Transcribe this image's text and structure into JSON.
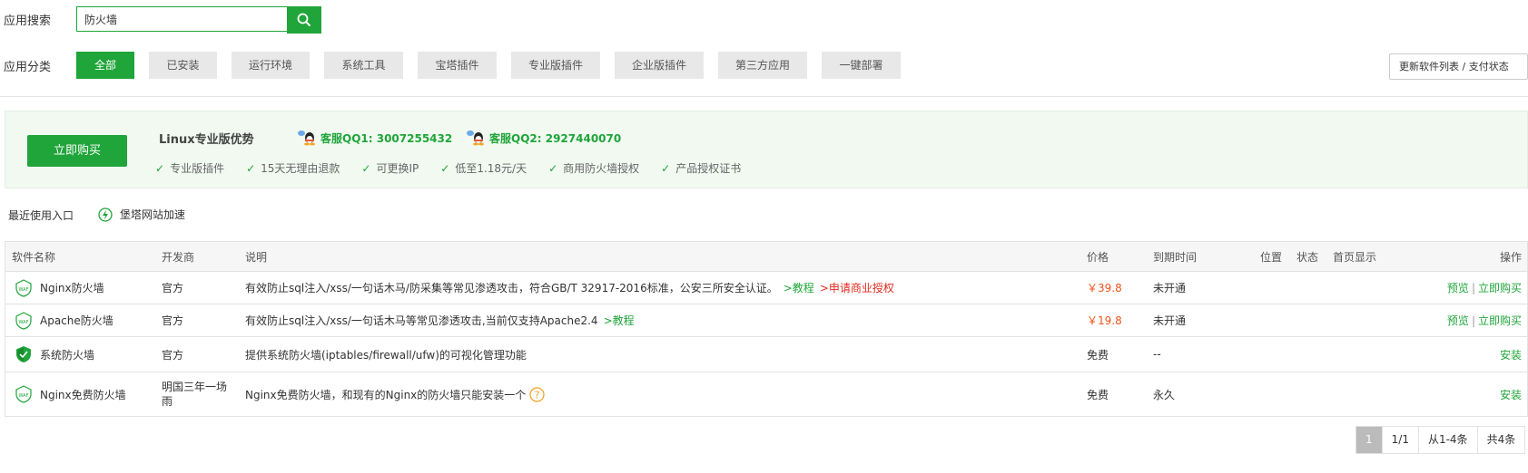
{
  "search": {
    "label": "应用搜索",
    "value": "防火墙"
  },
  "category": {
    "label": "应用分类",
    "tabs": [
      "全部",
      "已安装",
      "运行环境",
      "系统工具",
      "宝塔插件",
      "专业版插件",
      "企业版插件",
      "第三方应用",
      "一键部署"
    ],
    "active": "全部"
  },
  "update_button": "更新软件列表 / 支付状态",
  "promo": {
    "buy_button": "立即购买",
    "title": "Linux专业版优势",
    "qq1": "客服QQ1: 3007255432",
    "qq2": "客服QQ2: 2927440070",
    "benefits": [
      "专业版插件",
      "15天无理由退款",
      "可更换IP",
      "低至1.18元/天",
      "商用防火墙授权",
      "产品授权证书"
    ]
  },
  "recent": {
    "label": "最近使用入口",
    "item": "堡塔网站加速"
  },
  "table": {
    "headers": {
      "name": "软件名称",
      "dev": "开发商",
      "desc": "说明",
      "price": "价格",
      "expire": "到期时间",
      "loc": "位置",
      "status": "状态",
      "home": "首页显示",
      "op": "操作"
    },
    "rows": [
      {
        "name": "Nginx防火墙",
        "dev": "官方",
        "desc": "有效防止sql注入/xss/一句话木马/防采集等常见渗透攻击，符合GB/T 32917-2016标准，公安三所安全认证。",
        "link1": ">教程",
        "link2": ">申请商业授权",
        "price": "￥39.8",
        "expire": "未开通",
        "op1": "预览",
        "op2": "立即购买"
      },
      {
        "name": "Apache防火墙",
        "dev": "官方",
        "desc": "有效防止sql注入/xss/一句话木马等常见渗透攻击,当前仅支持Apache2.4",
        "link1": ">教程",
        "price": "￥19.8",
        "expire": "未开通",
        "op1": "预览",
        "op2": "立即购买"
      },
      {
        "name": "系统防火墙",
        "dev": "官方",
        "desc": "提供系统防火墙(iptables/firewall/ufw)的可视化管理功能",
        "price": "免费",
        "expire": "--",
        "op": "安装"
      },
      {
        "name": "Nginx免费防火墙",
        "dev_line1": "明国三年一场",
        "dev_line2": "雨",
        "desc": "Nginx免费防火墙，和现有的Nginx的防火墙只能安装一个",
        "price": "免费",
        "expire": "永久",
        "op": "安装"
      }
    ],
    "separator": "|"
  },
  "pagination": {
    "current": "1",
    "pages": "1/1",
    "range": "从1-4条",
    "total": "共4条"
  },
  "colors": {
    "accent": "#20a53a",
    "price": "#f0531a",
    "link_red": "#e2291c"
  }
}
